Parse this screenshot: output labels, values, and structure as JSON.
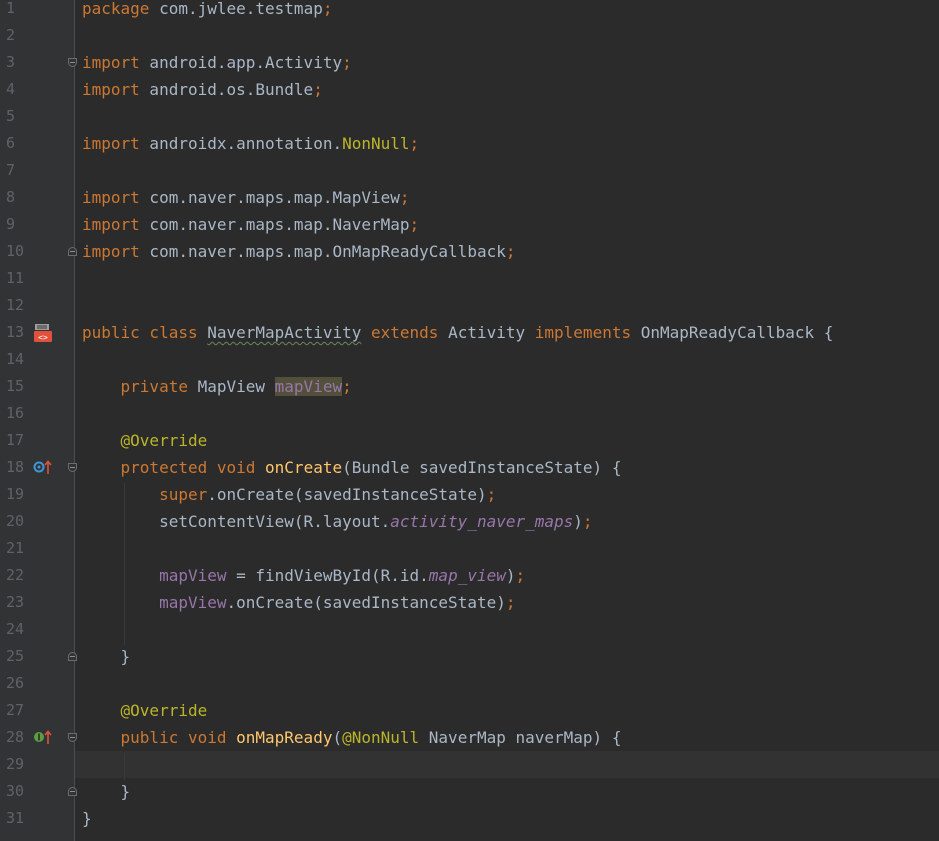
{
  "code_lines": [
    {
      "num": "1",
      "tokens": [
        {
          "t": "package",
          "c": "kw"
        },
        {
          "t": " com.jwlee.testmap"
        },
        {
          "t": ";",
          "c": "kw"
        }
      ]
    },
    {
      "num": "2",
      "tokens": []
    },
    {
      "num": "3",
      "tokens": [
        {
          "t": "import",
          "c": "kw"
        },
        {
          "t": " android.app.Activity"
        },
        {
          "t": ";",
          "c": "kw"
        }
      ]
    },
    {
      "num": "4",
      "tokens": [
        {
          "t": "import",
          "c": "kw"
        },
        {
          "t": " android.os.Bundle"
        },
        {
          "t": ";",
          "c": "kw"
        }
      ]
    },
    {
      "num": "5",
      "tokens": []
    },
    {
      "num": "6",
      "tokens": [
        {
          "t": "import",
          "c": "kw"
        },
        {
          "t": " androidx.annotation."
        },
        {
          "t": "NonNull",
          "c": "ann"
        },
        {
          "t": ";",
          "c": "kw"
        }
      ]
    },
    {
      "num": "7",
      "tokens": []
    },
    {
      "num": "8",
      "tokens": [
        {
          "t": "import",
          "c": "kw"
        },
        {
          "t": " com.naver.maps.map.MapView"
        },
        {
          "t": ";",
          "c": "kw"
        }
      ]
    },
    {
      "num": "9",
      "tokens": [
        {
          "t": "import",
          "c": "kw"
        },
        {
          "t": " com.naver.maps.map.NaverMap"
        },
        {
          "t": ";",
          "c": "kw"
        }
      ]
    },
    {
      "num": "10",
      "tokens": [
        {
          "t": "import",
          "c": "kw"
        },
        {
          "t": " com.naver.maps.map.OnMapReadyCallback"
        },
        {
          "t": ";",
          "c": "kw"
        }
      ]
    },
    {
      "num": "11",
      "tokens": []
    },
    {
      "num": "12",
      "tokens": []
    },
    {
      "num": "13",
      "tokens": [
        {
          "t": "public class ",
          "c": "kw"
        },
        {
          "t": "NaverMapActivity",
          "c": "squig"
        },
        {
          "t": " "
        },
        {
          "t": "extends ",
          "c": "kw"
        },
        {
          "t": "Activity "
        },
        {
          "t": "implements ",
          "c": "kw"
        },
        {
          "t": "OnMapReadyCallback {"
        }
      ]
    },
    {
      "num": "14",
      "tokens": []
    },
    {
      "num": "15",
      "tokens": [
        {
          "t": "    "
        },
        {
          "t": "private ",
          "c": "kw"
        },
        {
          "t": "MapView "
        },
        {
          "t": "mapView",
          "c": "fld hl"
        },
        {
          "t": ";",
          "c": "kw"
        }
      ]
    },
    {
      "num": "16",
      "tokens": []
    },
    {
      "num": "17",
      "tokens": [
        {
          "t": "    "
        },
        {
          "t": "@Override",
          "c": "ann"
        }
      ]
    },
    {
      "num": "18",
      "tokens": [
        {
          "t": "    "
        },
        {
          "t": "protected void ",
          "c": "kw"
        },
        {
          "t": "onCreate",
          "c": "fn"
        },
        {
          "t": "(Bundle savedInstanceState) {"
        }
      ]
    },
    {
      "num": "19",
      "tokens": [
        {
          "t": "        "
        },
        {
          "t": "super",
          "c": "kw"
        },
        {
          "t": ".onCreate(savedInstanceState)"
        },
        {
          "t": ";",
          "c": "kw"
        }
      ]
    },
    {
      "num": "20",
      "tokens": [
        {
          "t": "        setContentView(R.layout."
        },
        {
          "t": "activity_naver_maps",
          "c": "ital"
        },
        {
          "t": ")"
        },
        {
          "t": ";",
          "c": "kw"
        }
      ]
    },
    {
      "num": "21",
      "tokens": []
    },
    {
      "num": "22",
      "tokens": [
        {
          "t": "        "
        },
        {
          "t": "mapView",
          "c": "fld"
        },
        {
          "t": " = findViewById(R.id."
        },
        {
          "t": "map_view",
          "c": "ital"
        },
        {
          "t": ")"
        },
        {
          "t": ";",
          "c": "kw"
        }
      ]
    },
    {
      "num": "23",
      "tokens": [
        {
          "t": "        "
        },
        {
          "t": "mapView",
          "c": "fld"
        },
        {
          "t": ".onCreate(savedInstanceState)"
        },
        {
          "t": ";",
          "c": "kw"
        }
      ]
    },
    {
      "num": "24",
      "tokens": []
    },
    {
      "num": "25",
      "tokens": [
        {
          "t": "    }"
        }
      ]
    },
    {
      "num": "26",
      "tokens": []
    },
    {
      "num": "27",
      "tokens": [
        {
          "t": "    "
        },
        {
          "t": "@Override",
          "c": "ann"
        }
      ]
    },
    {
      "num": "28",
      "tokens": [
        {
          "t": "    "
        },
        {
          "t": "public void ",
          "c": "kw"
        },
        {
          "t": "onMapReady",
          "c": "fn"
        },
        {
          "t": "("
        },
        {
          "t": "@NonNull",
          "c": "ann"
        },
        {
          "t": " NaverMap naverMap) {"
        }
      ]
    },
    {
      "num": "29",
      "tokens": []
    },
    {
      "num": "30",
      "tokens": [
        {
          "t": "    }"
        }
      ]
    },
    {
      "num": "31",
      "tokens": [
        {
          "t": "}"
        }
      ]
    }
  ],
  "current_line": "29",
  "fold_markers": [
    {
      "line": "3",
      "kind": "top"
    },
    {
      "line": "10",
      "kind": "bottom"
    },
    {
      "line": "18",
      "kind": "top"
    },
    {
      "line": "25",
      "kind": "bottom"
    },
    {
      "line": "28",
      "kind": "top"
    },
    {
      "line": "30",
      "kind": "bottom"
    }
  ],
  "gutter_icons": [
    {
      "line": "13",
      "icon": "android-activity-icon"
    },
    {
      "line": "18",
      "icon": "overrides-method-icon"
    },
    {
      "line": "28",
      "icon": "implements-method-icon"
    }
  ],
  "colors": {
    "background": "#2b2b2b",
    "gutter": "#313335",
    "keyword": "#cc7832",
    "default_text": "#a9b7c6",
    "method_decl": "#ffc66d",
    "field": "#9876aa",
    "annotation": "#bbb529",
    "line_number": "#606366"
  }
}
